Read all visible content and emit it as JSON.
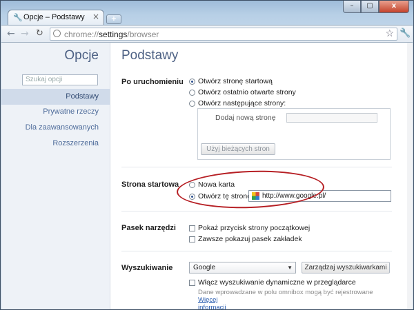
{
  "tab": {
    "title": "Opcje – Podstawy",
    "close": "×",
    "new_tab": "+"
  },
  "window_controls": {
    "minimize": "–",
    "maximize": "▢",
    "close": "x"
  },
  "toolbar": {
    "back": "←",
    "forward": "→",
    "reload": "↻",
    "url_scheme": "chrome://",
    "url_host": "settings",
    "url_path": "/browser",
    "star": "☆",
    "wrench": "🔧"
  },
  "sidebar": {
    "title": "Opcje",
    "search_placeholder": "Szukaj opcji",
    "items": [
      {
        "label": "Podstawy",
        "active": true
      },
      {
        "label": "Prywatne rzeczy"
      },
      {
        "label": "Dla zaawansowanych"
      },
      {
        "label": "Rozszerzenia"
      }
    ]
  },
  "main": {
    "title": "Podstawy",
    "startup": {
      "label": "Po uruchomieniu",
      "options": [
        "Otwórz stronę startową",
        "Otwórz ostatnio otwarte strony",
        "Otwórz następujące strony:"
      ],
      "selected_index": 0,
      "add_page": "Dodaj nową stronę",
      "use_current": "Użyj bieżących stron"
    },
    "homepage": {
      "label": "Strona startowa",
      "options": [
        "Nowa karta",
        "Otwórz tę stronę:"
      ],
      "selected_index": 1,
      "url": "http://www.google.pl/"
    },
    "toolbar_section": {
      "label": "Pasek narzędzi",
      "options": [
        "Pokaż przycisk strony początkowej",
        "Zawsze pokazuj pasek zakładek"
      ]
    },
    "search": {
      "label": "Wyszukiwanie",
      "engine": "Google",
      "manage": "Zarządzaj wyszukiwarkami",
      "instant": "Włącz wyszukiwanie dynamiczne w przeglądarce",
      "note": "Dane wprowadzane w polu omnibox mogą być rejestrowane",
      "more_1": "Więcej",
      "more_2": "informacji"
    }
  },
  "colors": {
    "highlight_ellipse": "#b61f24",
    "accent": "#4d6184"
  }
}
